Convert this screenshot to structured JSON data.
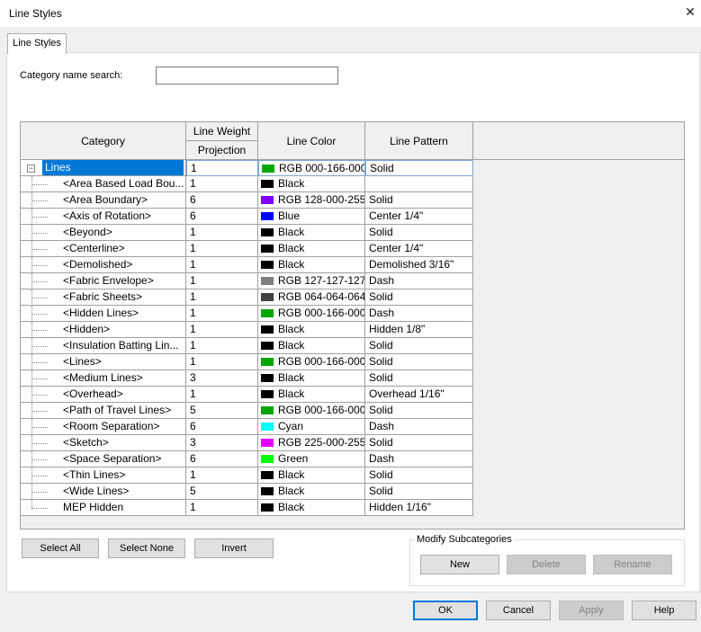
{
  "window": {
    "title": "Line Styles",
    "close_glyph": "✕"
  },
  "tabs": [
    {
      "label": "Line Styles"
    }
  ],
  "search": {
    "label": "Category name search:",
    "value": "",
    "placeholder": ""
  },
  "grid": {
    "headers": {
      "category": "Category",
      "line_weight": "Line Weight",
      "projection": "Projection",
      "line_color": "Line Color",
      "line_pattern": "Line Pattern"
    },
    "rows": [
      {
        "name": "Lines",
        "weight": "1",
        "color_name": "RGB 000-166-000",
        "color": "#00a600",
        "pattern": "Solid",
        "level": 0,
        "selected": true
      },
      {
        "name": "<Area Based Load Bou...",
        "weight": "1",
        "color_name": "Black",
        "color": "#000000",
        "pattern": "",
        "level": 1
      },
      {
        "name": "<Area Boundary>",
        "weight": "6",
        "color_name": "RGB 128-000-255",
        "color": "#8000ff",
        "pattern": "Solid",
        "level": 1
      },
      {
        "name": "<Axis of Rotation>",
        "weight": "6",
        "color_name": "Blue",
        "color": "#0000ff",
        "pattern": "Center 1/4\"",
        "level": 1
      },
      {
        "name": "<Beyond>",
        "weight": "1",
        "color_name": "Black",
        "color": "#000000",
        "pattern": "Solid",
        "level": 1
      },
      {
        "name": "<Centerline>",
        "weight": "1",
        "color_name": "Black",
        "color": "#000000",
        "pattern": "Center 1/4\"",
        "level": 1
      },
      {
        "name": "<Demolished>",
        "weight": "1",
        "color_name": "Black",
        "color": "#000000",
        "pattern": "Demolished 3/16\"",
        "level": 1
      },
      {
        "name": "<Fabric Envelope>",
        "weight": "1",
        "color_name": "RGB 127-127-127",
        "color": "#7f7f7f",
        "pattern": "Dash",
        "level": 1
      },
      {
        "name": "<Fabric Sheets>",
        "weight": "1",
        "color_name": "RGB 064-064-064",
        "color": "#404040",
        "pattern": "Solid",
        "level": 1
      },
      {
        "name": "<Hidden Lines>",
        "weight": "1",
        "color_name": "RGB 000-166-000",
        "color": "#00a600",
        "pattern": "Dash",
        "level": 1
      },
      {
        "name": "<Hidden>",
        "weight": "1",
        "color_name": "Black",
        "color": "#000000",
        "pattern": "Hidden 1/8\"",
        "level": 1
      },
      {
        "name": "<Insulation Batting Lin...",
        "weight": "1",
        "color_name": "Black",
        "color": "#000000",
        "pattern": "Solid",
        "level": 1
      },
      {
        "name": "<Lines>",
        "weight": "1",
        "color_name": "RGB 000-166-000",
        "color": "#00a600",
        "pattern": "Solid",
        "level": 1
      },
      {
        "name": "<Medium Lines>",
        "weight": "3",
        "color_name": "Black",
        "color": "#000000",
        "pattern": "Solid",
        "level": 1
      },
      {
        "name": "<Overhead>",
        "weight": "1",
        "color_name": "Black",
        "color": "#000000",
        "pattern": "Overhead 1/16\"",
        "level": 1
      },
      {
        "name": "<Path of Travel Lines>",
        "weight": "5",
        "color_name": "RGB 000-166-000",
        "color": "#00a600",
        "pattern": "Solid",
        "level": 1
      },
      {
        "name": "<Room Separation>",
        "weight": "6",
        "color_name": "Cyan",
        "color": "#00ffff",
        "pattern": "Dash",
        "level": 1
      },
      {
        "name": "<Sketch>",
        "weight": "3",
        "color_name": "RGB 225-000-255",
        "color": "#e100ff",
        "pattern": "Solid",
        "level": 1
      },
      {
        "name": "<Space Separation>",
        "weight": "6",
        "color_name": "Green",
        "color": "#00ff00",
        "pattern": "Dash",
        "level": 1
      },
      {
        "name": "<Thin Lines>",
        "weight": "1",
        "color_name": "Black",
        "color": "#000000",
        "pattern": "Solid",
        "level": 1
      },
      {
        "name": "<Wide Lines>",
        "weight": "5",
        "color_name": "Black",
        "color": "#000000",
        "pattern": "Solid",
        "level": 1
      },
      {
        "name": "MEP Hidden",
        "weight": "1",
        "color_name": "Black",
        "color": "#000000",
        "pattern": "Hidden 1/16\"",
        "level": 1
      }
    ]
  },
  "selection_buttons": {
    "select_all": "Select All",
    "select_none": "Select None",
    "invert": "Invert"
  },
  "modify_subcategories": {
    "label": "Modify Subcategories",
    "new": "New",
    "delete": "Delete",
    "rename": "Rename"
  },
  "footer_buttons": {
    "ok": "OK",
    "cancel": "Cancel",
    "apply": "Apply",
    "help": "Help"
  },
  "icons": {
    "close": "close-icon",
    "expander": "collapse-minus-icon"
  },
  "colors": {
    "selection": "#0078d7",
    "default_button_border": "#0078d7"
  }
}
